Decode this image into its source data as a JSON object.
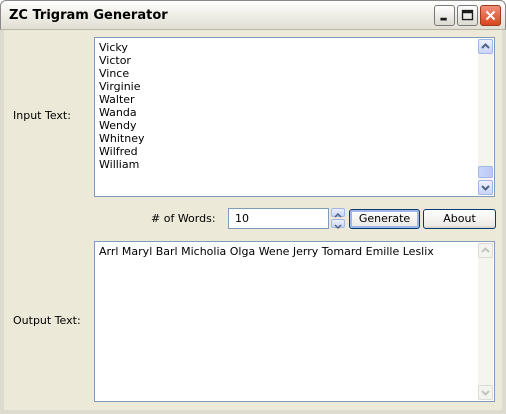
{
  "window": {
    "title": "ZC Trigram Generator"
  },
  "input": {
    "label": "Input Text:",
    "lines": [
      "Vicky",
      "Victor",
      "Vince",
      "Virginie",
      "Walter",
      "Wanda",
      "Wendy",
      "Whitney",
      "Wilfred",
      "William"
    ]
  },
  "controls": {
    "words_label": "# of Words:",
    "words_value": "10",
    "generate_label": "Generate",
    "about_label": "About"
  },
  "output": {
    "label": "Output Text:",
    "text": "Arrl Maryl Barl Micholia Olga Wene Jerry Tomard Emille Leslix"
  },
  "colors": {
    "titlebar_frame": "#0831d9",
    "face": "#ece9d8",
    "close": "#d8451f"
  }
}
